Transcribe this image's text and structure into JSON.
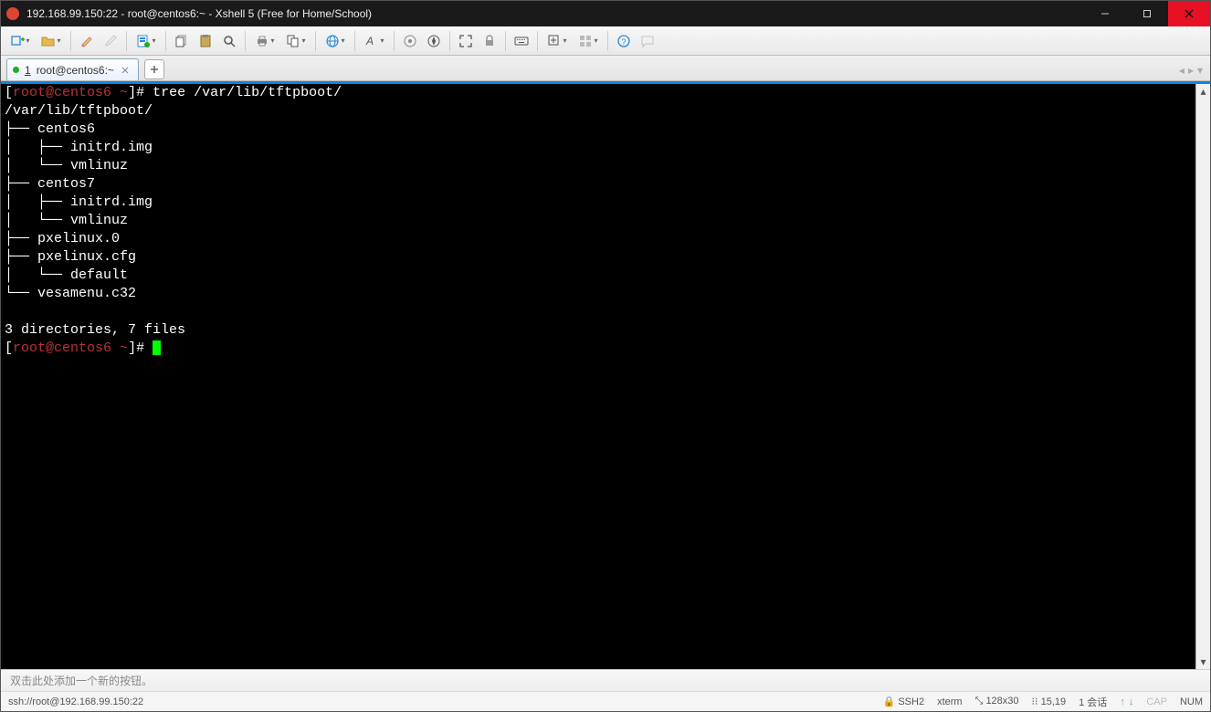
{
  "window": {
    "title": "192.168.99.150:22 - root@centos6:~ - Xshell 5 (Free for Home/School)"
  },
  "tab": {
    "number": "1",
    "label": "root@centos6:~"
  },
  "terminal": {
    "l1_prefix": "[",
    "l1_user": "root@centos6",
    "l1_tilde": " ~",
    "l1_close": "]# ",
    "l1_cmd": "tree /var/lib/tftpboot/",
    "l2": "/var/lib/tftpboot/",
    "l3": "├── centos6",
    "l4": "│   ├── initrd.img",
    "l5": "│   └── vmlinuz",
    "l6": "├── centos7",
    "l7": "│   ├── initrd.img",
    "l8": "│   └── vmlinuz",
    "l9": "├── pxelinux.0",
    "l10": "├── pxelinux.cfg",
    "l11": "│   └── default",
    "l12": "└── vesamenu.c32",
    "l13": "",
    "l14": "3 directories, 7 files",
    "l15_prefix": "[",
    "l15_user": "root@centos6",
    "l15_tilde": " ~",
    "l15_close": "]# "
  },
  "bottombar": {
    "hint": "双击此处添加一个新的按钮。"
  },
  "status": {
    "conn": "ssh://root@192.168.99.150:22",
    "ssh": "SSH2",
    "term": "xterm",
    "size": "128x30",
    "pos": "15,19",
    "sessions": "1 会话",
    "cap": "CAP",
    "num": "NUM"
  }
}
